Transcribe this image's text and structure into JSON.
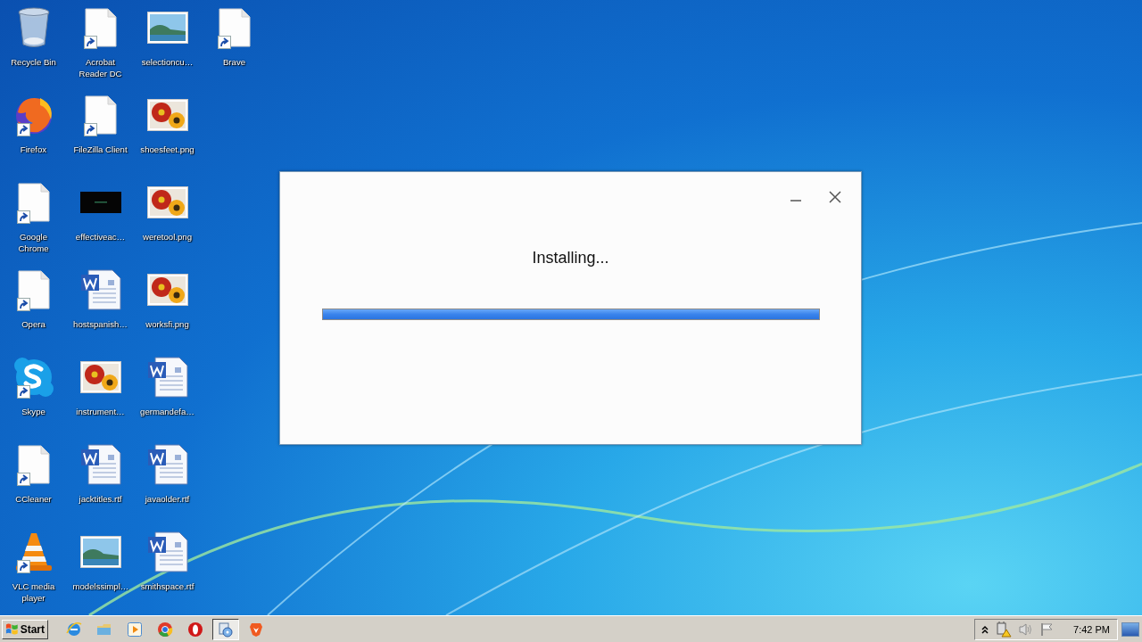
{
  "desktop": {
    "icons": [
      {
        "label": "Recycle Bin",
        "kind": "recycle",
        "shortcut": false
      },
      {
        "label": "Firefox",
        "kind": "firefox",
        "shortcut": true
      },
      {
        "label": "Google Chrome",
        "kind": "blank",
        "shortcut": true
      },
      {
        "label": "Opera",
        "kind": "blank",
        "shortcut": true
      },
      {
        "label": "Skype",
        "kind": "skype",
        "shortcut": true
      },
      {
        "label": "CCleaner",
        "kind": "blank",
        "shortcut": true
      },
      {
        "label": "VLC media player",
        "kind": "vlc",
        "shortcut": true
      },
      {
        "label": "Acrobat Reader DC",
        "kind": "blank",
        "shortcut": true
      },
      {
        "label": "FileZilla Client",
        "kind": "blank",
        "shortcut": true
      },
      {
        "label": "effectiveac…",
        "kind": "dark",
        "shortcut": false
      },
      {
        "label": "hostspanish…",
        "kind": "word",
        "shortcut": false
      },
      {
        "label": "instrument…",
        "kind": "flowers",
        "shortcut": false
      },
      {
        "label": "jacktitles.rtf",
        "kind": "word",
        "shortcut": false
      },
      {
        "label": "modelssimpl…",
        "kind": "landscape",
        "shortcut": false
      },
      {
        "label": "selectioncu…",
        "kind": "landscape",
        "shortcut": false
      },
      {
        "label": "shoesfeet.png",
        "kind": "flowers",
        "shortcut": false
      },
      {
        "label": "weretool.png",
        "kind": "flowers",
        "shortcut": false
      },
      {
        "label": "worksfi.png",
        "kind": "flowers",
        "shortcut": false
      },
      {
        "label": "germandefa…",
        "kind": "word",
        "shortcut": false
      },
      {
        "label": "javaolder.rtf",
        "kind": "word",
        "shortcut": false
      },
      {
        "label": "smithspace.rtf",
        "kind": "word",
        "shortcut": false
      },
      {
        "label": "Brave",
        "kind": "blank",
        "shortcut": true
      }
    ]
  },
  "dialog": {
    "message": "Installing...",
    "progress": {
      "level": 1
    }
  },
  "taskbar": {
    "start": "Start",
    "apps": [
      {
        "kind": "ie",
        "selected": false
      },
      {
        "kind": "folder",
        "selected": false
      },
      {
        "kind": "media",
        "selected": false
      },
      {
        "kind": "chrome",
        "selected": false
      },
      {
        "kind": "opera",
        "selected": false
      },
      {
        "kind": "installer",
        "selected": true
      },
      {
        "kind": "brave",
        "selected": false
      }
    ],
    "tray": {
      "time": "7:42 PM"
    }
  }
}
